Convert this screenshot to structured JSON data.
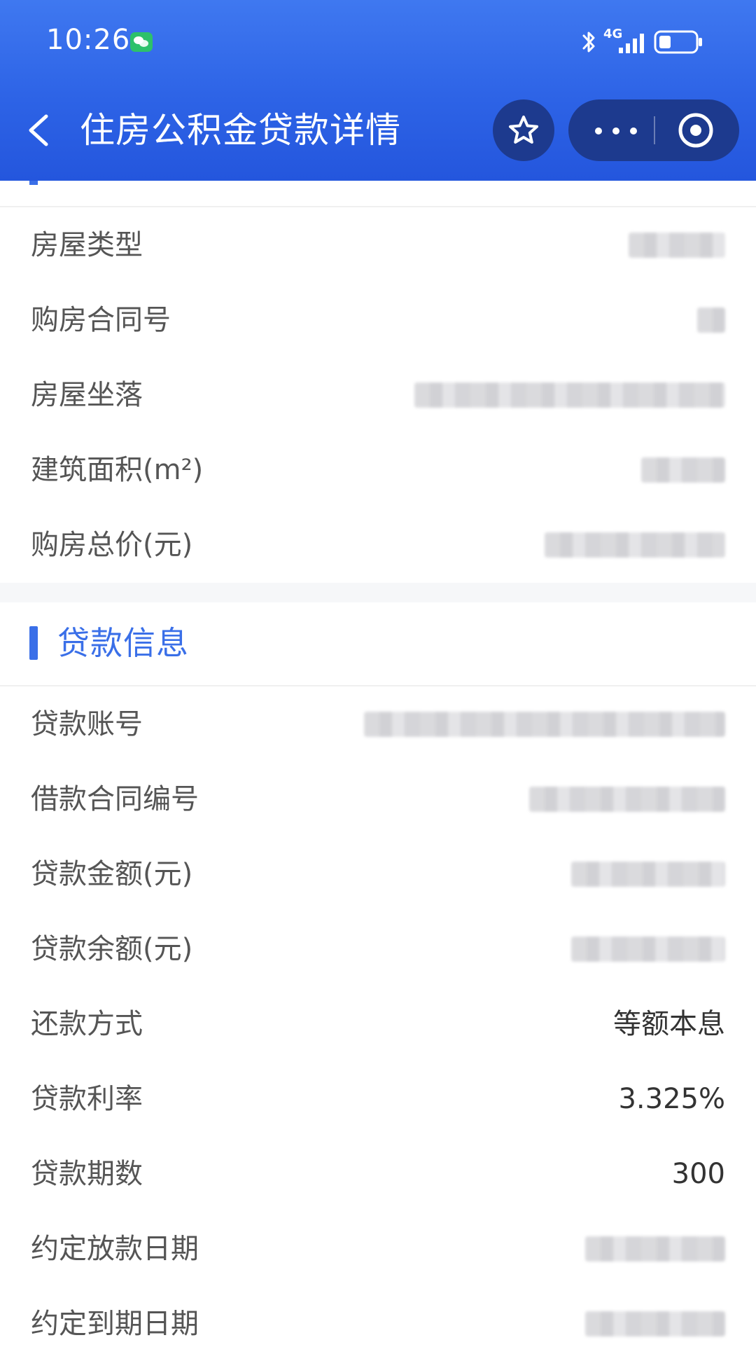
{
  "status_bar": {
    "time": "10:26",
    "network": "4G",
    "icons": [
      "wechat-icon",
      "bluetooth-icon",
      "signal-icon",
      "battery-icon"
    ]
  },
  "nav": {
    "title": "住房公积金贷款详情",
    "icons": [
      "back-arrow-icon",
      "star-icon",
      "more-icon",
      "target-icon"
    ]
  },
  "house_info": {
    "rows": [
      {
        "label": "房屋类型",
        "value": ""
      },
      {
        "label": "购房合同号",
        "value": ""
      },
      {
        "label": "房屋坐落",
        "value": ""
      },
      {
        "label": "建筑面积(m²)",
        "value": ""
      },
      {
        "label": "购房总价(元)",
        "value": ""
      }
    ]
  },
  "loan_info": {
    "section_title": "贷款信息",
    "rows": [
      {
        "label": "贷款账号",
        "value": ""
      },
      {
        "label": "借款合同编号",
        "value": ""
      },
      {
        "label": "贷款金额(元)",
        "value": ""
      },
      {
        "label": "贷款余额(元)",
        "value": ""
      },
      {
        "label": "还款方式",
        "value": "等额本息"
      },
      {
        "label": "贷款利率",
        "value": "3.325%"
      },
      {
        "label": "贷款期数",
        "value": "300"
      },
      {
        "label": "约定放款日期",
        "value": ""
      },
      {
        "label": "约定到期日期",
        "value": ""
      }
    ]
  },
  "colors": {
    "header_blue": "#2d63e6",
    "capsule_dark": "#1d3a8e",
    "accent_blue": "#3a6fe8",
    "wechat_green": "#2dc16a"
  }
}
